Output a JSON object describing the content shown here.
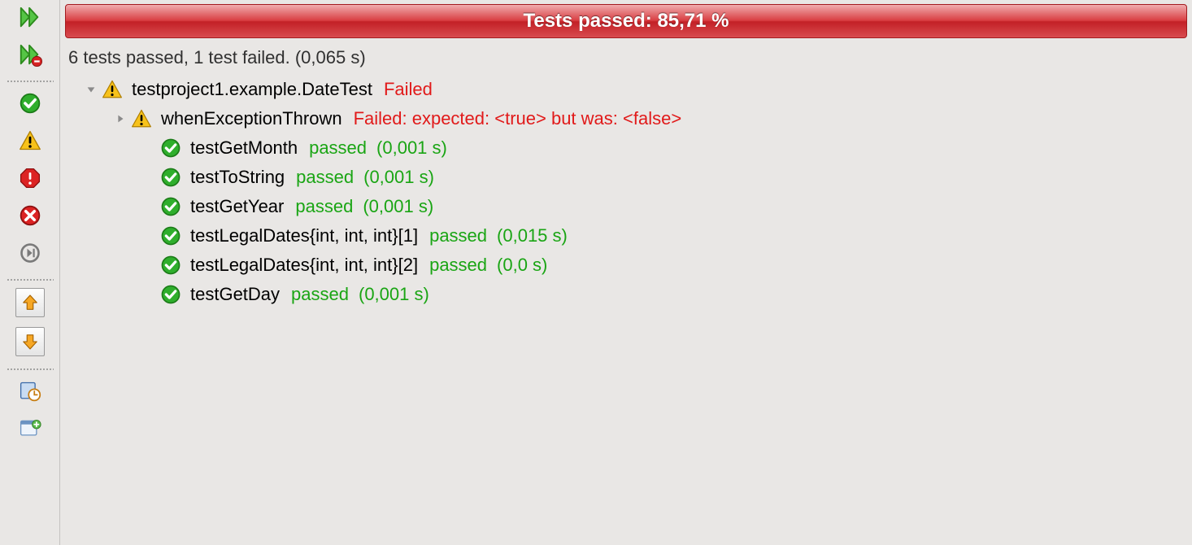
{
  "banner": {
    "text": "Tests passed: 85,71 %"
  },
  "summary": {
    "text": "6 tests passed, 1 test failed. (0,065 s)"
  },
  "tree": {
    "suite": {
      "name": "testproject1.example.DateTest",
      "status": "Failed"
    },
    "failCase": {
      "name": "whenExceptionThrown",
      "status": "Failed: expected: <true> but was: <false>"
    },
    "passCases": [
      {
        "name": "testGetMonth",
        "status": "passed",
        "time": "(0,001 s)"
      },
      {
        "name": "testToString",
        "status": "passed",
        "time": "(0,001 s)"
      },
      {
        "name": "testGetYear",
        "status": "passed",
        "time": "(0,001 s)"
      },
      {
        "name": "testLegalDates{int, int, int}[1]",
        "status": "passed",
        "time": "(0,015 s)"
      },
      {
        "name": "testLegalDates{int, int, int}[2]",
        "status": "passed",
        "time": "(0,0 s)"
      },
      {
        "name": "testGetDay",
        "status": "passed",
        "time": "(0,001 s)"
      }
    ]
  },
  "toolbar": {
    "rerun": "rerun",
    "rerunFailed": "rerun-failed",
    "filterPassed": "filter-passed",
    "filterWarn": "filter-warnings",
    "filterError": "filter-errors",
    "stop": "stop",
    "next": "next",
    "prevFailure": "previous-failure",
    "nextFailure": "next-failure",
    "history": "history",
    "newWindow": "new-window"
  }
}
